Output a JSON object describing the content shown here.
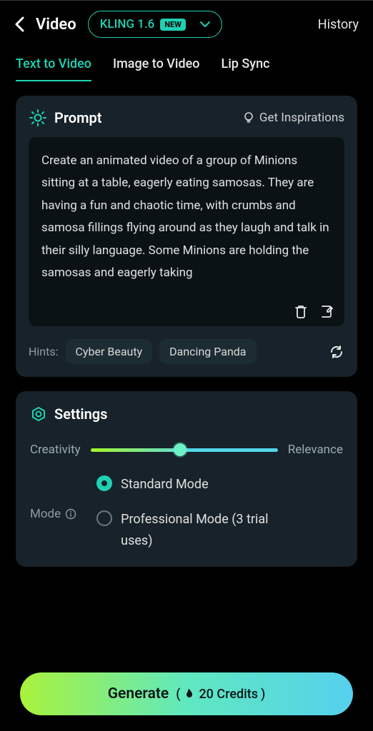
{
  "header": {
    "title": "Video",
    "model": "KLING 1.6",
    "badge": "NEW",
    "history": "History"
  },
  "tabs": [
    "Text to Video",
    "Image to Video",
    "Lip Sync"
  ],
  "active_tab": 0,
  "prompt": {
    "title": "Prompt",
    "inspire": "Get Inspirations",
    "text": "Create an animated video of a group of Minions sitting at a table, eagerly eating samosas. They are having a fun and chaotic time, with crumbs and samosa fillings flying around as they laugh and talk in their silly language. Some Minions are holding the samosas and eagerly taking",
    "hints_label": "Hints:",
    "hints": [
      "Cyber Beauty",
      "Dancing Panda"
    ]
  },
  "settings": {
    "title": "Settings",
    "creativity_label": "Creativity",
    "relevance_label": "Relevance",
    "slider_value": 48,
    "mode_label": "Mode",
    "options": [
      "Standard Mode",
      "Professional Mode (3 trial uses)"
    ],
    "selected_option": 0
  },
  "generate": {
    "label": "Generate",
    "cost": "20 Credits"
  }
}
